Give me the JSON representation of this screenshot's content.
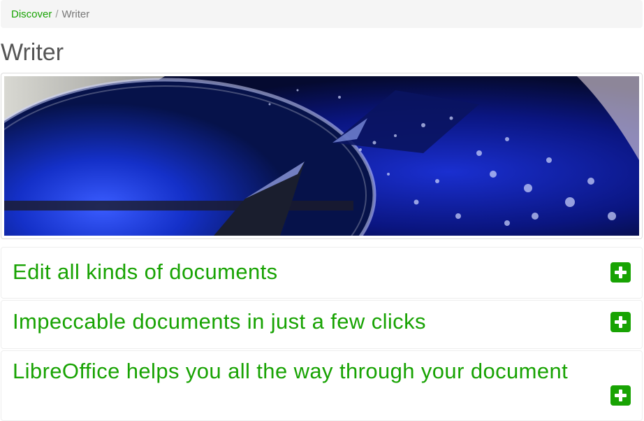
{
  "breadcrumb": {
    "items": [
      {
        "label": "Discover"
      }
    ],
    "separator": "/",
    "current": "Writer"
  },
  "page": {
    "title": "Writer"
  },
  "banner": {
    "description": "Macro photo of a fountain pen nib with blue ink and bubbles"
  },
  "panels": [
    {
      "title": "Edit all kinds of documents",
      "icon": "plus-square-icon"
    },
    {
      "title": "Impeccable documents in just a few clicks",
      "icon": "plus-square-icon"
    },
    {
      "title": "LibreOffice helps you all the way through your document",
      "icon": "plus-square-icon"
    }
  ],
  "colors": {
    "accent": "#18a303",
    "breadcrumb_bg": "#f5f5f5",
    "title_text": "#555555"
  }
}
